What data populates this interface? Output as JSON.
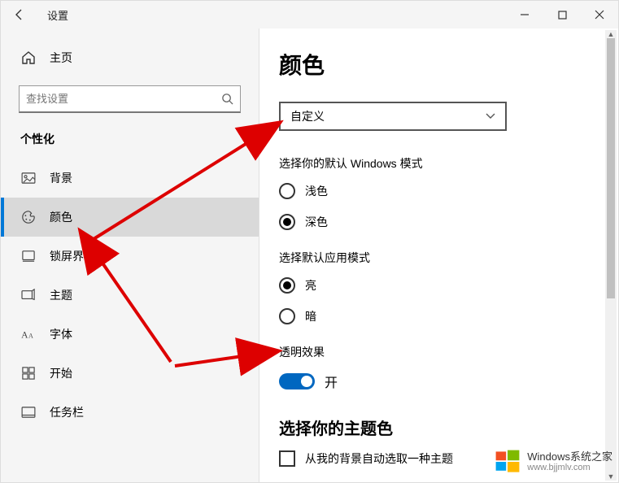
{
  "window": {
    "title": "设置",
    "controls": {
      "min": "minimize",
      "max": "maximize",
      "close": "close"
    }
  },
  "sidebar": {
    "home_label": "主页",
    "search_placeholder": "查找设置",
    "category_label": "个性化",
    "items": [
      {
        "label": "背景",
        "icon": "picture"
      },
      {
        "label": "颜色",
        "icon": "palette"
      },
      {
        "label": "锁屏界面",
        "icon": "lock-screen"
      },
      {
        "label": "主题",
        "icon": "theme"
      },
      {
        "label": "字体",
        "icon": "font"
      },
      {
        "label": "开始",
        "icon": "start"
      },
      {
        "label": "任务栏",
        "icon": "taskbar"
      }
    ]
  },
  "main": {
    "title": "颜色",
    "mode_dropdown": {
      "value": "自定义"
    },
    "windows_mode": {
      "label": "选择你的默认 Windows 模式",
      "light": "浅色",
      "dark": "深色",
      "selected": "dark"
    },
    "app_mode": {
      "label": "选择默认应用模式",
      "light": "亮",
      "dark": "暗",
      "selected": "light"
    },
    "transparency": {
      "label": "透明效果",
      "state_label": "开",
      "enabled": true
    },
    "accent": {
      "label": "选择你的主题色",
      "auto_checkbox_label": "从我的背景自动选取一种主题"
    }
  },
  "watermark": {
    "brand": "Windows系统之家",
    "url": "www.bjjmlv.com"
  }
}
